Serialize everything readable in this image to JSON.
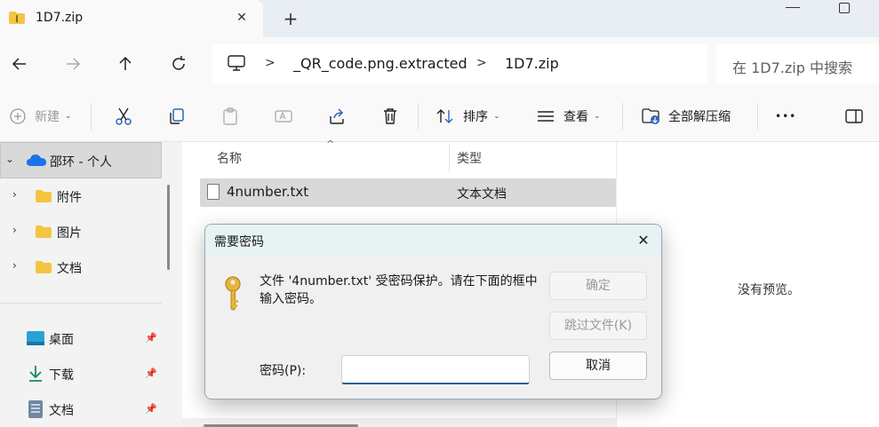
{
  "tab": {
    "title": "1D7.zip",
    "close_glyph": "✕",
    "new_tab_glyph": "+"
  },
  "address": {
    "crumbs": [
      "_QR_code.png.extracted",
      "1D7.zip"
    ],
    "separator": ">"
  },
  "search": {
    "placeholder": "在 1D7.zip 中搜索"
  },
  "toolbar": {
    "new_label": "新建",
    "sort_label": "排序",
    "view_label": "查看",
    "extract_all_label": "全部解压缩",
    "more_glyph": "•••"
  },
  "sidebar": {
    "account": "邵环 - 个人",
    "folders": [
      "附件",
      "图片",
      "文档"
    ],
    "quick_access": [
      "桌面",
      "下载",
      "文档"
    ]
  },
  "filelist": {
    "columns": {
      "name": "名称",
      "type": "类型"
    },
    "rows": [
      {
        "name": "4number.txt",
        "type": "文本文档"
      }
    ]
  },
  "preview": {
    "empty_text": "没有预览。"
  },
  "dialog": {
    "title": "需要密码",
    "message": "文件 '4number.txt' 受密码保护。请在下面的框中输入密码。",
    "password_label": "密码(P):",
    "password_value": "",
    "ok_label": "确定",
    "skip_label": "跳过文件(K)",
    "cancel_label": "取消"
  },
  "colors": {
    "accent": "#2f5f9a",
    "folder": "#f4c542",
    "key": "#e7b53a",
    "onedrive": "#1a73e8"
  }
}
